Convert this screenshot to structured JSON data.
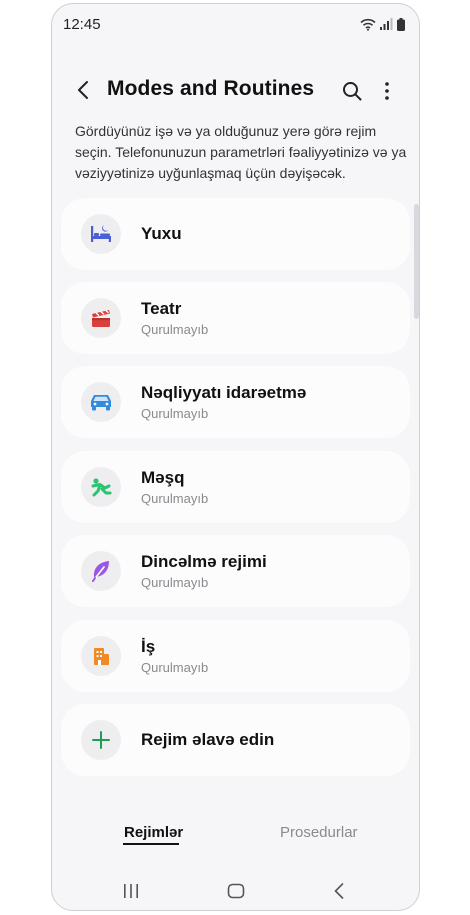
{
  "status_bar": {
    "time": "12:45"
  },
  "app_bar": {
    "title": "Modes and Routines"
  },
  "description": "Gördüyünüz işə və ya olduğunuz yerə görə rejim seçin. Telefonunuzun parametrləri fəaliyyətinizə və ya vəziyyətinizə uyğunlaşmaq üçün dəyişəcək.",
  "modes": [
    {
      "title": "Yuxu",
      "subtitle": "",
      "icon": "bed-icon",
      "color": "#4a5fd6"
    },
    {
      "title": "Teatr",
      "subtitle": "Qurulmayıb",
      "icon": "clapperboard-icon",
      "color": "#d9403a"
    },
    {
      "title": "Nəqliyyatı idarəetmə",
      "subtitle": "Qurulmayıb",
      "icon": "car-icon",
      "color": "#2f8be0"
    },
    {
      "title": "Məşq",
      "subtitle": "Qurulmayıb",
      "icon": "running-icon",
      "color": "#2ac36e"
    },
    {
      "title": "Dincəlmə rejimi",
      "subtitle": "Qurulmayıb",
      "icon": "leaf-icon",
      "color": "#9a58e0"
    },
    {
      "title": "İş",
      "subtitle": "Qurulmayıb",
      "icon": "building-icon",
      "color": "#f08a24"
    }
  ],
  "add_mode": {
    "title": "Rejim əlavə edin",
    "icon": "plus-icon",
    "color": "#1f9d57"
  },
  "tabs": {
    "modes": "Rejimlər",
    "routines": "Prosedurlar"
  }
}
